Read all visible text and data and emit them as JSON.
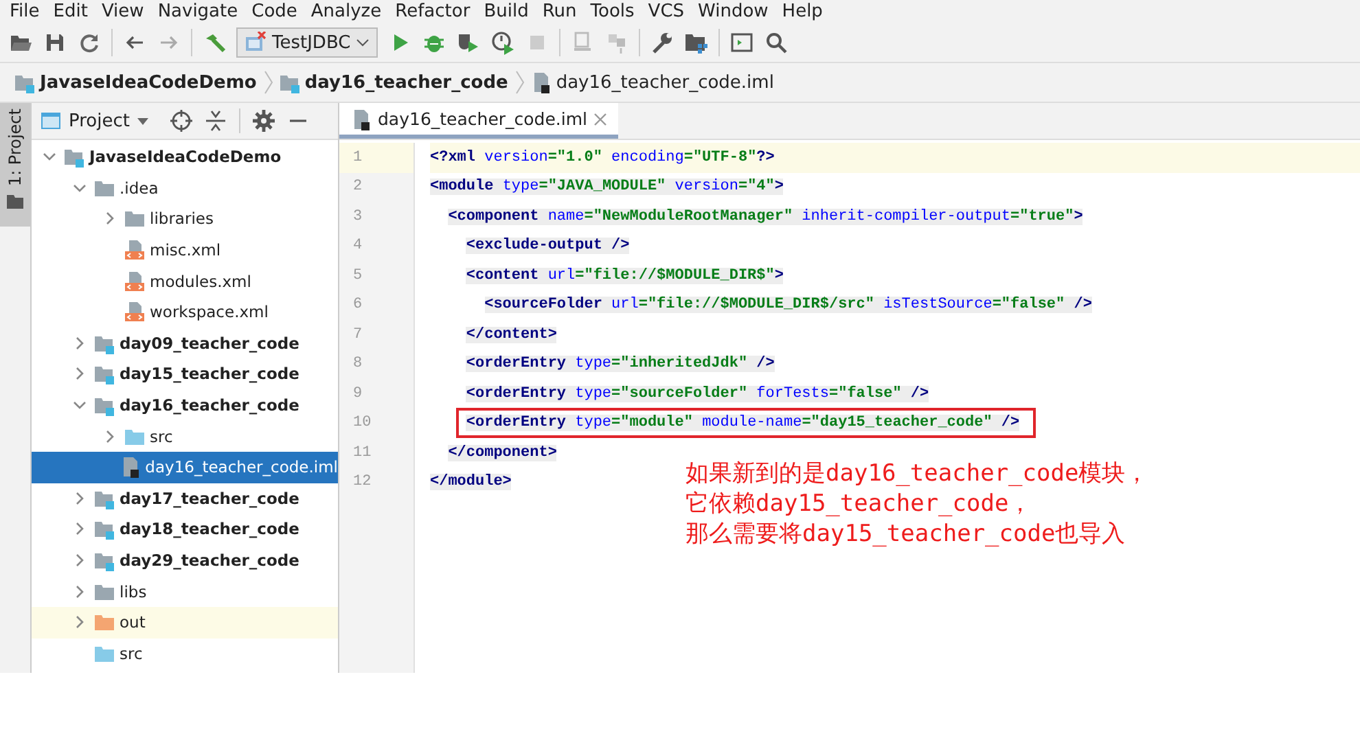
{
  "menu_bar": [
    {
      "label": "File"
    },
    {
      "label": "Edit"
    },
    {
      "label": "View"
    },
    {
      "label": "Navigate"
    },
    {
      "label": "Code"
    },
    {
      "label": "Analyze"
    },
    {
      "label": "Refactor"
    },
    {
      "label": "Build"
    },
    {
      "label": "Run"
    },
    {
      "label": "Tools"
    },
    {
      "label": "VCS"
    },
    {
      "label": "Window"
    },
    {
      "label": "Help"
    }
  ],
  "toolbar": {
    "run_configuration": "TestJDBC"
  },
  "breadcrumbs": [
    {
      "label": "JavaseIdeaCodeDemo",
      "kind": "module"
    },
    {
      "label": "day16_teacher_code",
      "kind": "module"
    },
    {
      "label": "day16_teacher_code.iml",
      "kind": "iml"
    }
  ],
  "side_tab": {
    "label": "1: Project"
  },
  "project_panel": {
    "title": "Project",
    "tree": [
      {
        "label": "JavaseIdeaCodeDemo",
        "kind": "module",
        "expanded": true,
        "selected": false,
        "children": [
          {
            "label": ".idea",
            "kind": "folder",
            "expanded": true,
            "selected": false,
            "children": [
              {
                "label": "libraries",
                "kind": "folder",
                "expanded": false,
                "selected": false
              },
              {
                "label": "misc.xml",
                "kind": "xml",
                "selected": false
              },
              {
                "label": "modules.xml",
                "kind": "xml",
                "selected": false
              },
              {
                "label": "workspace.xml",
                "kind": "xml",
                "selected": false
              }
            ]
          },
          {
            "label": "day09_teacher_code",
            "kind": "module",
            "expanded": false,
            "selected": false
          },
          {
            "label": "day15_teacher_code",
            "kind": "module",
            "expanded": false,
            "selected": false
          },
          {
            "label": "day16_teacher_code",
            "kind": "module",
            "expanded": true,
            "selected": false,
            "children": [
              {
                "label": "src",
                "kind": "source",
                "expanded": false,
                "selected": false
              },
              {
                "label": "day16_teacher_code.iml",
                "kind": "iml",
                "selected": true
              }
            ]
          },
          {
            "label": "day17_teacher_code",
            "kind": "module",
            "expanded": false,
            "selected": false
          },
          {
            "label": "day18_teacher_code",
            "kind": "module",
            "expanded": false,
            "selected": false
          },
          {
            "label": "day29_teacher_code",
            "kind": "module",
            "expanded": false,
            "selected": false
          },
          {
            "label": "libs",
            "kind": "folder",
            "expanded": false,
            "selected": false
          },
          {
            "label": "out",
            "kind": "output",
            "expanded": false,
            "selected": false
          },
          {
            "label": "src",
            "kind": "source",
            "selected": false
          }
        ]
      }
    ]
  },
  "editor": {
    "tabs": [
      {
        "label": "day16_teacher_code.iml",
        "selected": true
      }
    ],
    "lines": [
      {
        "number": "1",
        "current": true,
        "boxed": false,
        "tokens": [
          {
            "kind": "tag",
            "text": "<?xml"
          },
          {
            "kind": "attr",
            "text": " version"
          },
          {
            "kind": "value",
            "text": "=\"1.0\""
          },
          {
            "kind": "attr",
            "text": " encoding"
          },
          {
            "kind": "value",
            "text": "=\"UTF-8\""
          },
          {
            "kind": "tag",
            "text": "?>"
          }
        ]
      },
      {
        "number": "2",
        "current": false,
        "boxed": false,
        "tokens": [
          {
            "kind": "tag",
            "text": "<module"
          },
          {
            "kind": "attr",
            "text": " type"
          },
          {
            "kind": "value",
            "text": "=\"JAVA_MODULE\""
          },
          {
            "kind": "attr",
            "text": " version"
          },
          {
            "kind": "value",
            "text": "=\"4\""
          },
          {
            "kind": "tag",
            "text": ">"
          }
        ]
      },
      {
        "number": "3",
        "current": false,
        "boxed": false,
        "tokens": [
          {
            "kind": "tag",
            "text": "  <component"
          },
          {
            "kind": "attr",
            "text": " name"
          },
          {
            "kind": "value",
            "text": "=\"NewModuleRootManager\""
          },
          {
            "kind": "attr",
            "text": " inherit-compiler-output"
          },
          {
            "kind": "value",
            "text": "=\"true\""
          },
          {
            "kind": "tag",
            "text": ">"
          }
        ]
      },
      {
        "number": "4",
        "current": false,
        "boxed": false,
        "tokens": [
          {
            "kind": "tag",
            "text": "    <exclude-output />"
          }
        ]
      },
      {
        "number": "5",
        "current": false,
        "boxed": false,
        "tokens": [
          {
            "kind": "tag",
            "text": "    <content"
          },
          {
            "kind": "attr",
            "text": " url"
          },
          {
            "kind": "value",
            "text": "=\"file://$MODULE_DIR$\""
          },
          {
            "kind": "tag",
            "text": ">"
          }
        ]
      },
      {
        "number": "6",
        "current": false,
        "boxed": false,
        "tokens": [
          {
            "kind": "tag",
            "text": "      <sourceFolder"
          },
          {
            "kind": "attr",
            "text": " url"
          },
          {
            "kind": "value",
            "text": "=\"file://$MODULE_DIR$/src\""
          },
          {
            "kind": "attr",
            "text": " isTestSource"
          },
          {
            "kind": "value",
            "text": "=\"false\""
          },
          {
            "kind": "tag",
            "text": " />"
          }
        ]
      },
      {
        "number": "7",
        "current": false,
        "boxed": false,
        "tokens": [
          {
            "kind": "tag",
            "text": "    </content>"
          }
        ]
      },
      {
        "number": "8",
        "current": false,
        "boxed": false,
        "tokens": [
          {
            "kind": "tag",
            "text": "    <orderEntry"
          },
          {
            "kind": "attr",
            "text": " type"
          },
          {
            "kind": "value",
            "text": "=\"inheritedJdk\""
          },
          {
            "kind": "tag",
            "text": " />"
          }
        ]
      },
      {
        "number": "9",
        "current": false,
        "boxed": false,
        "tokens": [
          {
            "kind": "tag",
            "text": "    <orderEntry"
          },
          {
            "kind": "attr",
            "text": " type"
          },
          {
            "kind": "value",
            "text": "=\"sourceFolder\""
          },
          {
            "kind": "attr",
            "text": " forTests"
          },
          {
            "kind": "value",
            "text": "=\"false\""
          },
          {
            "kind": "tag",
            "text": " />"
          }
        ]
      },
      {
        "number": "10",
        "current": false,
        "boxed": true,
        "tokens": [
          {
            "kind": "tag",
            "text": "    <orderEntry"
          },
          {
            "kind": "attr",
            "text": " type"
          },
          {
            "kind": "value",
            "text": "=\"module\""
          },
          {
            "kind": "attr",
            "text": " module-name"
          },
          {
            "kind": "value",
            "text": "=\"day15_teacher_code\""
          },
          {
            "kind": "tag",
            "text": " />"
          }
        ]
      },
      {
        "number": "11",
        "current": false,
        "boxed": false,
        "tokens": [
          {
            "kind": "tag",
            "text": "  </component>"
          }
        ]
      },
      {
        "number": "12",
        "current": false,
        "boxed": false,
        "tokens": [
          {
            "kind": "tag",
            "text": "</module>"
          }
        ]
      }
    ],
    "annotation": [
      "如果新到的是day16_teacher_code模块，",
      "它依赖day15_teacher_code，",
      "那么需要将day15_teacher_code也导入"
    ]
  }
}
